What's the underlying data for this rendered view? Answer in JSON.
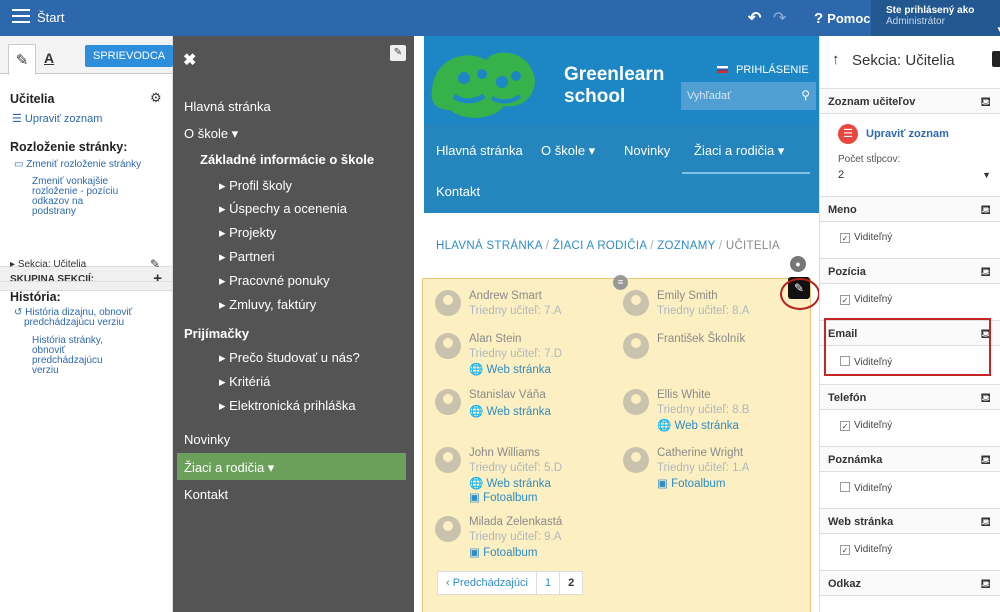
{
  "topbar": {
    "start": "Štart",
    "help": "Pomoc",
    "user_line1": "Ste prihlásený ako",
    "user_line2": "Administrátor"
  },
  "left": {
    "guide": "SPRIEVODCA",
    "tab_text": "A",
    "section": "Učitelia",
    "edit_list": "Upraviť zoznam",
    "layout_title": "Rozloženie stránky:",
    "layout_link": "Zmeniť rozloženie stránky",
    "layout_sub": [
      "Zmeniť vonkajšie",
      "rozloženie - pozíciu",
      "odkazov na",
      "podstrany"
    ],
    "group": "SKUPINA SEKCIÍ:",
    "group_item": "Sekcia: Učitelia",
    "history_title": "História:",
    "history_link": [
      "História dizajnu, obnoviť",
      "predchádzajúcu verziu"
    ],
    "history_sub": [
      "História stránky,",
      "obnoviť",
      "predchádzajúcu",
      "verziu"
    ]
  },
  "menu": {
    "items": [
      "Hlavná stránka",
      "O škole ▾",
      "Základné informácie o škole",
      "▸ Profil školy",
      "▸ Úspechy a ocenenia",
      "▸ Projekty",
      "▸ Partneri",
      "▸ Pracovné ponuky",
      "▸ Zmluvy, faktúry",
      "Prijímačky",
      "▸ Prečo študovať u nás?",
      "▸ Kritériá",
      "▸ Elektronická prihláška",
      "Novinky",
      "Žiaci a rodičia ▾",
      "Kontakt"
    ]
  },
  "site": {
    "name1": "Greenlearn",
    "name2": "school",
    "login": "PRIHLÁSENIE",
    "search": "Vyhľadať",
    "nav": [
      "Hlavná stránka",
      "O škole ▾",
      "Novinky",
      "Žiaci a rodičia ▾",
      "Kontakt"
    ],
    "breadcrumb": [
      "HLAVNÁ STRÁNKA",
      "/",
      "ŽIACI A RODIČIA",
      "/",
      "ZOZNAMY",
      "/",
      "UČITELIA"
    ],
    "teachers": [
      {
        "name": "Andrew Smart",
        "role": "Triedny učiteľ: 7.A",
        "links": []
      },
      {
        "name": "Emily Smith",
        "role": "Triedny učiteľ: 8.A",
        "links": []
      },
      {
        "name": "Alan Stein",
        "role": "Triedny učiteľ: 7.D",
        "links": [
          "Web stránka"
        ]
      },
      {
        "name": "František Školník",
        "role": "",
        "links": []
      },
      {
        "name": "Stanislav Váňa",
        "role": "",
        "links": [
          "Web stránka"
        ]
      },
      {
        "name": "Ellis White",
        "role": "Triedny učiteľ: 8.B",
        "links": [
          "Web stránka"
        ]
      },
      {
        "name": "John Williams",
        "role": "Triedny učiteľ: 5.D",
        "links": [
          "Web stránka",
          "Fotoalbum"
        ]
      },
      {
        "name": "Catherine Wright",
        "role": "Triedny učiteľ: 1.A",
        "links": [
          "Fotoalbum"
        ]
      },
      {
        "name": "Milada Zelenkastá",
        "role": "Triedny učiteľ: 9.A",
        "links": [
          "Fotoalbum"
        ]
      }
    ],
    "pager": [
      "‹ Predchádzajúci",
      "1",
      "2"
    ]
  },
  "right": {
    "title": "Sekcia: Učitelia",
    "rows": [
      "Zoznam učiteľov",
      "Meno",
      "Pozícia",
      "Email",
      "Telefón",
      "Poznámka",
      "Web stránka",
      "Odkaz"
    ],
    "edit_list": "Upraviť zoznam",
    "cols_label": "Počet stĺpcov:",
    "cols_value": "2",
    "visible": "Viditeľný"
  }
}
